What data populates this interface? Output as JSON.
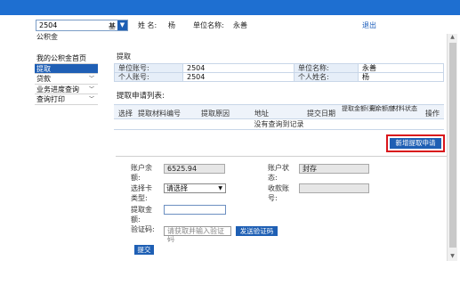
{
  "header": {
    "account_value": "2504",
    "account_cut": "基",
    "name_label": "姓 名:",
    "name_value": "杨",
    "org_label": "单位名称:",
    "org_value": "永善",
    "logout": "退出",
    "site": "公积金"
  },
  "sidebar": {
    "items": [
      {
        "label": "我的公积金首页"
      },
      {
        "label": "提取"
      },
      {
        "label": "贷款"
      },
      {
        "label": "业务进度查询"
      },
      {
        "label": "查询打印"
      }
    ]
  },
  "section": {
    "title": "提取",
    "acct_no_label": "单位账号:",
    "acct_no_value": "2504",
    "acct_name_label": "单位名称:",
    "acct_name_value": "永善",
    "person_no_label": "个人账号:",
    "person_no_value": "2504",
    "person_name_label": "个人姓名:",
    "person_name_value": "杨"
  },
  "list": {
    "title": "提取申请列表:",
    "columns": [
      "选择",
      "提取材料编号",
      "提取原因",
      "地址",
      "提交日期",
      "提取金额(元)",
      "剩余额度",
      "材料状态",
      "操作"
    ],
    "empty": "没有查询到记录"
  },
  "actions": {
    "new_apply": "新增提取申请",
    "send_code": "发送验证码",
    "submit": "提交"
  },
  "form": {
    "balance_label": "账户余额:",
    "balance_value": "6525.94",
    "status_label": "账户状态:",
    "status_value": "封存",
    "card_type_label": "选择卡类型:",
    "card_type_value": "请选择",
    "payee_label": "收款账号:",
    "amount_label": "提取金额:",
    "amount_value": "",
    "verify_label": "验证码:",
    "verify_placeholder": "请获取并输入验证码"
  },
  "colors": {
    "brand_blue": "#1e6fd1",
    "button_blue": "#1e5fb4",
    "highlight_red": "#d9151b"
  }
}
